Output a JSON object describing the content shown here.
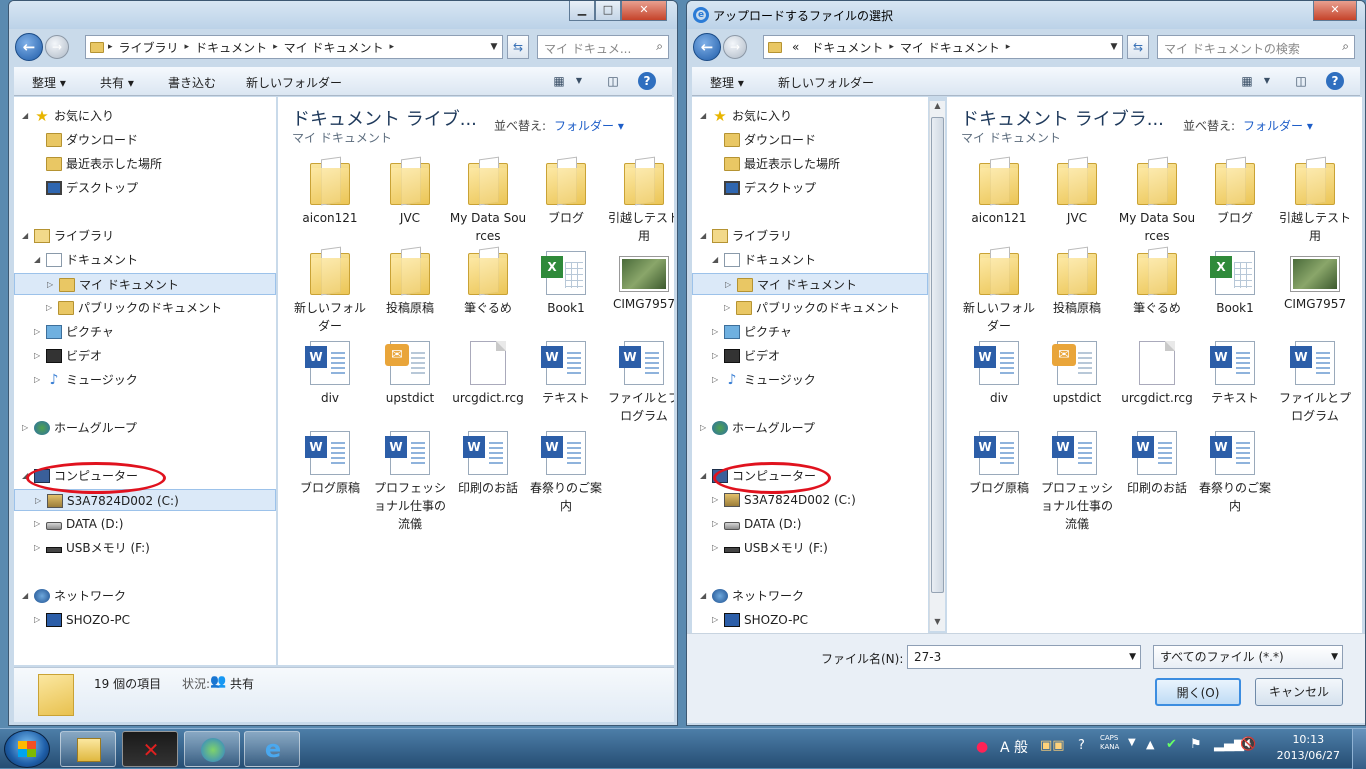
{
  "left_window": {
    "address": [
      "ライブラリ",
      "ドキュメント",
      "マイ ドキュメント"
    ],
    "search_placeholder": "マイ ドキュメ...",
    "toolbar": {
      "organize": "整理 ▾",
      "share": "共有 ▾",
      "burn": "書き込む",
      "new_folder": "新しいフォルダー"
    },
    "library_title": "ドキュメント ライブ...",
    "library_sub": "マイ ドキュメント",
    "arrange_label": "並べ替え:",
    "arrange_value": "フォルダー ▾",
    "status": {
      "count": "19 個の項目",
      "state_label": "状況:",
      "state_value": "共有"
    }
  },
  "right_window": {
    "title": "アップロードするファイルの選択",
    "address": [
      "«",
      "ドキュメント",
      "マイ ドキュメント"
    ],
    "search_placeholder": "マイ ドキュメントの検索",
    "toolbar": {
      "organize": "整理 ▾",
      "new_folder": "新しいフォルダー"
    },
    "library_title": "ドキュメント ライブラ...",
    "library_sub": "マイ ドキュメント",
    "arrange_label": "並べ替え:",
    "arrange_value": "フォルダー ▾",
    "filename_label": "ファイル名(N):",
    "filename_value": "27-3",
    "filetype_value": "すべてのファイル (*.*)",
    "open_button": "開く(O)",
    "cancel_button": "キャンセル"
  },
  "nav_tree": [
    {
      "label": "お気に入り",
      "icon": "star-icon"
    },
    {
      "label": "ダウンロード",
      "icon": "download-folder-icon"
    },
    {
      "label": "最近表示した場所",
      "icon": "recent-places-icon"
    },
    {
      "label": "デスクトップ",
      "icon": "desktop-icon"
    },
    {
      "label": "ライブラリ",
      "icon": "library-icon"
    },
    {
      "label": "ドキュメント",
      "icon": "documents-icon"
    },
    {
      "label": "マイ ドキュメント",
      "icon": "folder-icon"
    },
    {
      "label": "パブリックのドキュメント",
      "icon": "folder-icon"
    },
    {
      "label": "ピクチャ",
      "icon": "pictures-icon"
    },
    {
      "label": "ビデオ",
      "icon": "videos-icon"
    },
    {
      "label": "ミュージック",
      "icon": "music-icon"
    },
    {
      "label": "ホームグループ",
      "icon": "homegroup-icon"
    },
    {
      "label": "コンピューター",
      "icon": "computer-icon"
    },
    {
      "label": "S3A7824D002 (C:)",
      "icon": "drive-c-icon"
    },
    {
      "label": "DATA (D:)",
      "icon": "drive-icon"
    },
    {
      "label": "USBメモリ (F:)",
      "icon": "usb-drive-icon"
    },
    {
      "label": "ネットワーク",
      "icon": "network-icon"
    },
    {
      "label": "SHOZO-PC",
      "icon": "pc-icon"
    }
  ],
  "files": [
    {
      "name": "aicon121",
      "type": "folder"
    },
    {
      "name": "JVC",
      "type": "folder"
    },
    {
      "name": "My Data Sources",
      "type": "folder"
    },
    {
      "name": "ブログ",
      "type": "folder"
    },
    {
      "name": "引越しテスト用",
      "type": "folder"
    },
    {
      "name": "新しいフォルダー",
      "type": "folder"
    },
    {
      "name": "投稿原稿",
      "type": "folder"
    },
    {
      "name": "筆ぐるめ",
      "type": "folder"
    },
    {
      "name": "Book1",
      "type": "excel"
    },
    {
      "name": "CIMG7957",
      "type": "photo"
    },
    {
      "name": "div",
      "type": "word"
    },
    {
      "name": "upstdict",
      "type": "outlook"
    },
    {
      "name": "urcgdict.rcg",
      "type": "blank"
    },
    {
      "name": "テキスト",
      "type": "word"
    },
    {
      "name": "ファイルとプログラム",
      "type": "word"
    },
    {
      "name": "ブログ原稿",
      "type": "word"
    },
    {
      "name": "プロフェッショナル仕事の流儀",
      "type": "word"
    },
    {
      "name": "印刷のお話",
      "type": "word"
    },
    {
      "name": "春祭りのご案内",
      "type": "word"
    }
  ],
  "taskbar": {
    "tray_ime": "A 般",
    "tray_caps": "CAPS",
    "tray_kana": "KANA",
    "time": "10:13",
    "date": "2013/06/27"
  },
  "colors": {
    "accent": "#1e5ec8",
    "highlight_ellipse": "#e0121e",
    "selection": "#dbe9f8"
  }
}
